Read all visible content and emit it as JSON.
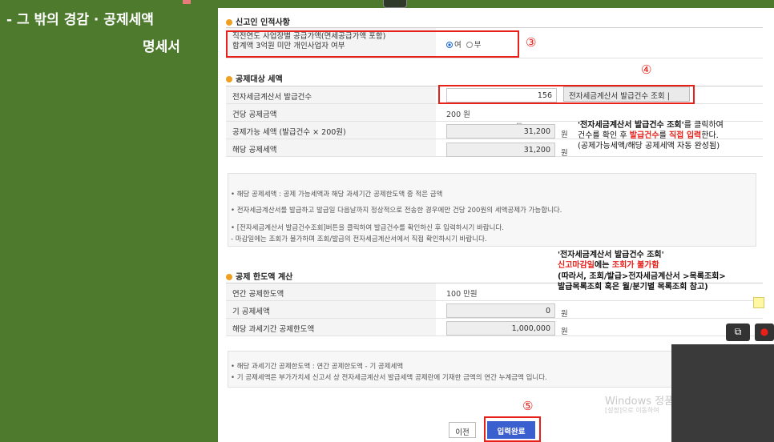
{
  "sidebar": {
    "title_line1": "- 그 밖의 경감 · 공제세액",
    "title_line2": "명세서"
  },
  "section_declarant": {
    "title": "신고인 인적사항",
    "question_line1": "직전연도 사업장별 공급가액(면세공급가액 포함)",
    "question_line2": "합계액 3억원 미만 개인사업자 여부",
    "option_yes": "여",
    "option_no": "부"
  },
  "section_deduction": {
    "title": "공제대상 세액",
    "rows": [
      {
        "label": "전자세금계산서 발급건수",
        "value": "156"
      },
      {
        "label": "건당 공제금액",
        "value": "200 원"
      },
      {
        "label": "공제가능 세액 (발급건수 × 200원)",
        "value": "31,200",
        "unit": "원"
      },
      {
        "label": "해당 공제세액",
        "value": "31,200",
        "unit": "원"
      }
    ],
    "issue_count_button": "전자세금계산서 발급건수 조회",
    "notes": [
      "• 해당 공제세액 : 공제 가능세액과 해당 과세기간 공제한도액 중 적은 금액",
      "• 전자세금계산서를 발급하고 발급일 다음날까지 정상적으로 전송한 경우에만 건당 200원의 세액공제가 가능합니다.",
      "• [전자세금계산서 발급건수조회]버튼을 클릭하여 발급건수를 확인하신 후 입력하시기 바랍니다.",
      "  - 마감일에는 조회가 불가하며 조회/발급의 전자세금계산서에서 직접 확인하시기 바랍니다."
    ]
  },
  "section_limit": {
    "title": "공제 한도액 계산",
    "rows": [
      {
        "label": "연간 공제한도액",
        "value": "100 만원"
      },
      {
        "label": "기 공제세액",
        "value": "0",
        "unit": "원"
      },
      {
        "label": "해당 과세기간 공제한도액",
        "value": "1,000,000",
        "unit": "원"
      }
    ],
    "notes": [
      "• 해당 과세기간 공제한도액 : 연간 공제한도액 - 기 공제세액",
      "• 기 공제세액은 부가가치세 신고서 상 전자세금계산서 발급세액 공제란에 기재한 금액의 연간 누계금액 입니다."
    ]
  },
  "buttons": {
    "prev": "이전",
    "complete": "입력완료"
  },
  "markers": {
    "m3": "③",
    "m4": "④",
    "m5": "⑤"
  },
  "annotation1": {
    "l1a": "'전자세금계산서 발급건수 조회'",
    "l1b": "를 클릭하여",
    "l2a": "건수를  확인 후 ",
    "l2b": "발급건수",
    "l2c": "를 ",
    "l2d": "직접 입력",
    "l2e": "한다.",
    "l3": "(공제가능세액/해당 공제세액 자동 완성됨)"
  },
  "annotation2": {
    "l1": "'전자세금계산서 발급건수 조회'",
    "l2a": "신고마감일",
    "l2b": "에는 ",
    "l2c": "조회가 불가함",
    "l3": "(따라서, 조회/발급>전자세금계산서 >목록조회>",
    "l4": "발급목록조회  혹은 월/분기별 목록조회 참고)"
  },
  "watermark": {
    "line1": "Windows 정품",
    "line2": "[설정]으로 이동하여"
  },
  "cam_buttons": {
    "a": "⧉",
    "b": "●"
  },
  "colors": {
    "accent_red": "#e8201a",
    "primary_button": "#3a5fcf",
    "sidebar_green": "#4e7a2e"
  }
}
